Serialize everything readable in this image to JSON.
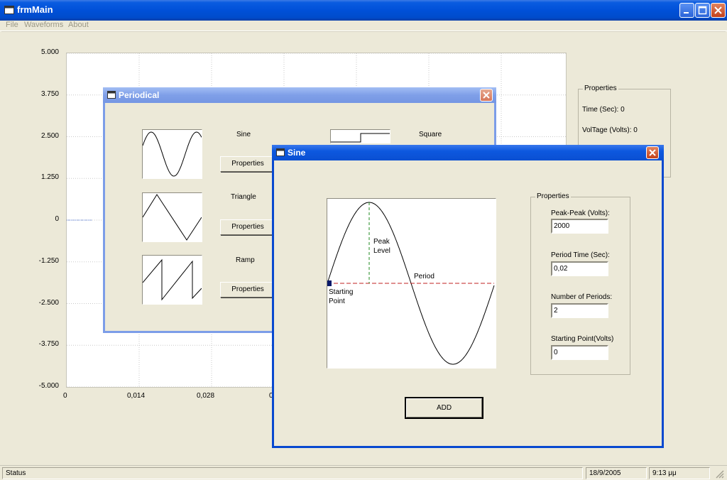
{
  "main": {
    "title": "frmMain",
    "menu": [
      "File",
      "Waveforms",
      "About"
    ],
    "chart_data": {
      "type": "line",
      "title": "",
      "xlabel": "",
      "ylabel": "",
      "y_ticks": [
        "5.000",
        "3.750",
        "2.500",
        "1.250",
        "0",
        "-1.250",
        "-2.500",
        "-3.750",
        "-5.000"
      ],
      "x_ticks": [
        "0",
        "0,014",
        "0,028",
        "0"
      ],
      "ylim": [
        -5,
        5
      ],
      "grid": true,
      "series": [
        {
          "x": [
            0,
            0.0035
          ],
          "y": [
            0,
            0
          ]
        }
      ]
    },
    "properties": {
      "legend": "Properties",
      "time": "Time (Sec): 0",
      "voltage": "VolTage (Volts): 0"
    },
    "status": {
      "text": "Status",
      "date": "18/9/2005",
      "time": "9:13 μμ"
    }
  },
  "periodical": {
    "title": "Periodical",
    "waveforms": [
      {
        "label": "Sine",
        "button": "Properties"
      },
      {
        "label": "Triangle",
        "button": "Properties"
      },
      {
        "label": "Ramp",
        "button": "Properties"
      },
      {
        "label": "Square"
      }
    ]
  },
  "sine": {
    "title": "Sine",
    "diagram": {
      "peak_level": [
        "Peak",
        "Level"
      ],
      "period": "Period",
      "starting_point": [
        "Starting",
        "Point"
      ]
    },
    "properties": {
      "legend": "Properties",
      "fields": [
        {
          "label": "Peak-Peak (Volts):",
          "value": "2000"
        },
        {
          "label": "Period Time (Sec):",
          "value": "0,02"
        },
        {
          "label": "Number of Periods:",
          "value": "2"
        },
        {
          "label": "Starting Point(Volts)",
          "value": "0"
        }
      ]
    },
    "add_button": "ADD"
  },
  "colors": {
    "titlebar": "#0050d8",
    "peak_line": "#1f8a1f",
    "period_line": "#c02020",
    "start_marker": "#0a1a6a"
  }
}
